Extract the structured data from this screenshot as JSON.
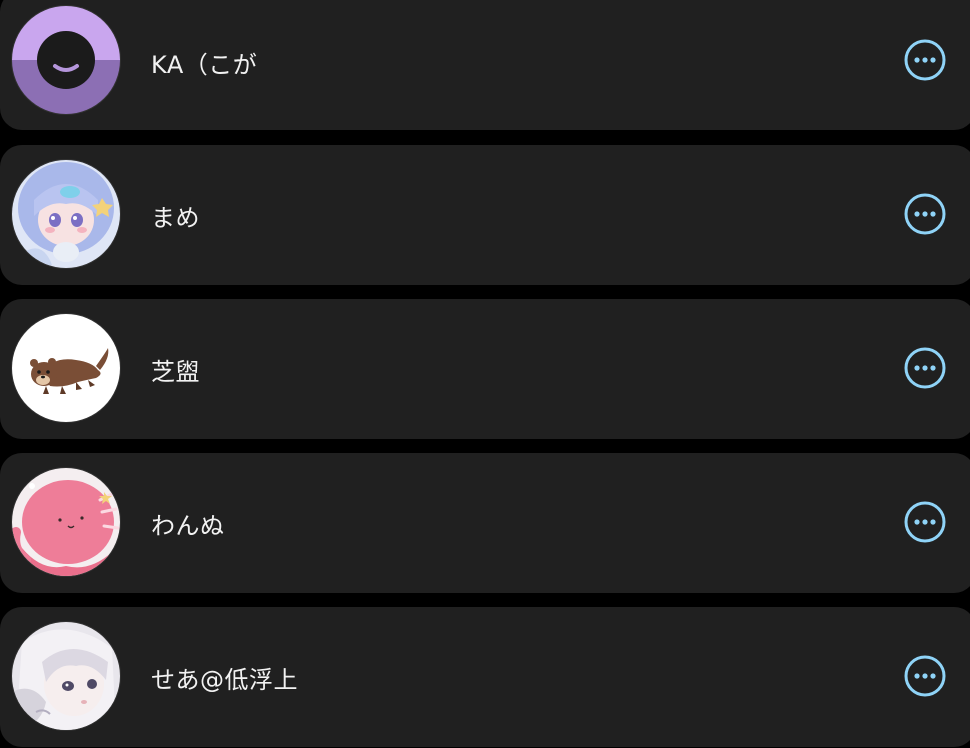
{
  "colors": {
    "background": "#000000",
    "card": "#202020",
    "text": "#f2f2f2",
    "accent": "#8fd3f7"
  },
  "users": [
    {
      "name": "KA（こが",
      "avatar": "default-smile-avatar",
      "action_icon": "more-horizontal-icon"
    },
    {
      "name": "まめ",
      "avatar": "anime-girl-blue-hair-avatar",
      "action_icon": "more-horizontal-icon"
    },
    {
      "name": "芝盥",
      "avatar": "otter-illustration-avatar",
      "action_icon": "more-horizontal-icon"
    },
    {
      "name": "わんぬ",
      "avatar": "pink-octopus-avatar",
      "action_icon": "more-horizontal-icon"
    },
    {
      "name": "せあ@低浮上",
      "avatar": "anime-girl-white-hair-avatar",
      "action_icon": "more-horizontal-icon"
    }
  ]
}
